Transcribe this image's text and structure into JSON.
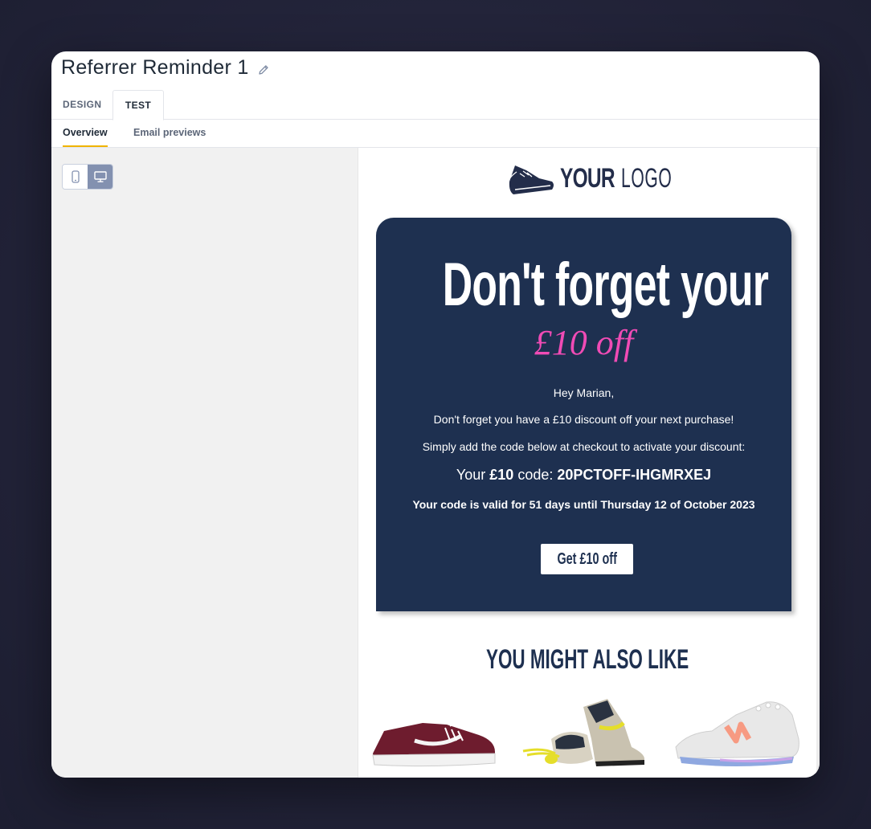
{
  "header": {
    "title": "Referrer Reminder 1",
    "edit_icon": "pencil-icon"
  },
  "tabs": [
    {
      "label": "DESIGN",
      "active": false
    },
    {
      "label": "TEST",
      "active": true
    }
  ],
  "subtabs": [
    {
      "label": "Overview",
      "active": true
    },
    {
      "label": "Email previews",
      "active": false
    }
  ],
  "device_toggle": {
    "options": [
      "mobile-icon",
      "desktop-icon"
    ],
    "selected": "desktop-icon"
  },
  "email": {
    "logo": {
      "your": "YOUR",
      "logo": "LOGO",
      "icon": "sneaker-icon"
    },
    "headline": "Don't forget your",
    "headline_offer": "£10 off",
    "greeting": "Hey Marian,",
    "line1": "Don't forget you have a £10 discount off your next purchase!",
    "line2": "Simply add the code below at checkout to activate your discount:",
    "code_prefix": "Your",
    "code_amount": "£10",
    "code_mid": "code:",
    "code_value": "20PCTOFF-IHGMRXEJ",
    "valid_text": "Your code is valid for 51 days until Thursday 12 of October 2023",
    "cta_label": "Get £10 off",
    "section_title": "YOU MIGHT ALSO LIKE",
    "products": [
      "burgundy-skate-shoe-image",
      "yellow-high-top-sneakers-image",
      "white-running-shoe-image"
    ]
  },
  "colors": {
    "accent": "#f0b400",
    "card_bg": "#1e3050",
    "offer_pink": "#f04bb5",
    "toggle_active": "#8391b0"
  }
}
